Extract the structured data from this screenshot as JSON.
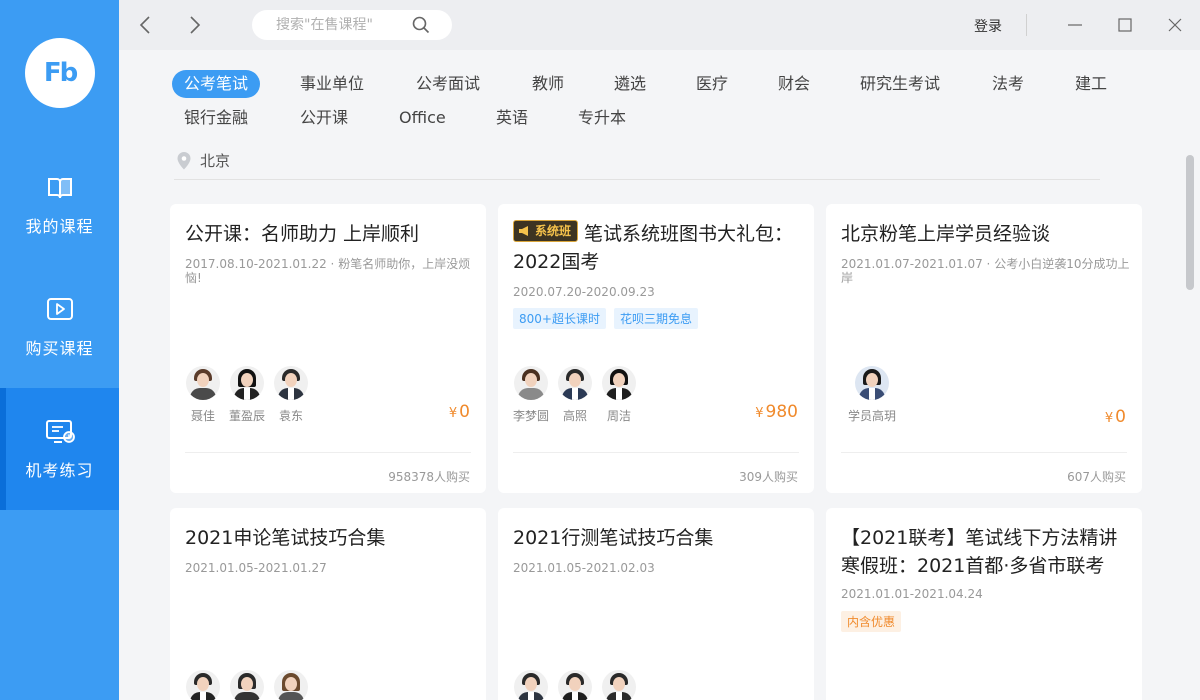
{
  "sidebar": {
    "logo_text": "Fb",
    "items": [
      {
        "label": "我的课程",
        "icon": "book-icon"
      },
      {
        "label": "购买课程",
        "icon": "play-icon"
      },
      {
        "label": "机考练习",
        "icon": "computer-exam-icon"
      }
    ],
    "active_index": 2
  },
  "topbar": {
    "search_placeholder": "搜索\"在售课程\"",
    "login_label": "登录"
  },
  "categories": [
    "公考笔试",
    "事业单位",
    "公考面试",
    "教师",
    "遴选",
    "医疗",
    "财会",
    "研究生考试",
    "法考",
    "建工",
    "银行金融",
    "公开课",
    "Office",
    "英语",
    "专升本"
  ],
  "active_category": "公考笔试",
  "location": "北京",
  "courses": [
    {
      "title": "公开课：名师助力 上岸顺利",
      "meta": "2017.08.10-2021.01.22 · 粉笔名师助你，上岸没烦恼!",
      "teachers": [
        "聂佳",
        "董盈辰",
        "袁东"
      ],
      "price": "0",
      "buyers": "958378人购买"
    },
    {
      "badge": "系统班",
      "title": "笔试系统班图书大礼包：2022国考",
      "meta": "2020.07.20-2020.09.23",
      "tags": [
        "800+超长课时",
        "花呗三期免息"
      ],
      "teachers": [
        "李梦圆",
        "高照",
        "周洁"
      ],
      "price": "980",
      "buyers": "309人购买"
    },
    {
      "title": "北京粉笔上岸学员经验谈",
      "meta": "2021.01.07-2021.01.07 · 公考小白逆袭10分成功上岸",
      "teachers": [
        "学员高玥"
      ],
      "price": "0",
      "buyers": "607人购买"
    },
    {
      "title": "2021申论笔试技巧合集",
      "meta": "2021.01.05-2021.01.27"
    },
    {
      "title": "2021行测笔试技巧合集",
      "meta": "2021.01.05-2021.02.03"
    },
    {
      "title": "【2021联考】笔试线下方法精讲寒假班：2021首都·多省市联考",
      "meta": "2021.01.01-2021.04.24",
      "tags": [
        "内含优惠"
      ]
    }
  ],
  "currency_symbol": "¥",
  "colors": {
    "sidebar": "#3c9cf3",
    "sidebar_active": "#1f86ee",
    "accent": "#3c9cf3",
    "price": "#f08a2c"
  }
}
